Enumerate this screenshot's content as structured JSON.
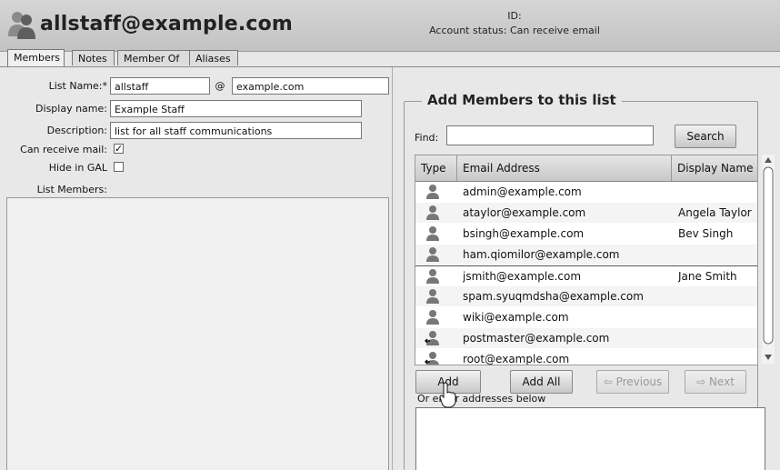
{
  "header": {
    "title": "allstaff@example.com",
    "id_label": "ID:",
    "account_status": "Account status:  Can receive email"
  },
  "tabs": [
    "Members",
    "Notes",
    "Member Of",
    "Aliases"
  ],
  "form": {
    "list_name_label": "List Name:*",
    "list_name_value": "allstaff",
    "at_sign": "@",
    "domain_value": "example.com",
    "display_name_label": "Display name:",
    "display_name_value": "Example Staff",
    "description_label": "Description:",
    "description_value": "list for all staff communications",
    "can_receive_label": "Can receive mail:",
    "can_receive_checked": true,
    "hide_gal_label": "Hide in GAL",
    "hide_gal_checked": false,
    "list_members_label": "List Members:"
  },
  "add_panel": {
    "legend": "Add Members to this list",
    "find_label": "Find:",
    "find_value": "",
    "search_button": "Search",
    "columns": [
      "Type",
      "Email Address",
      "Display Name"
    ],
    "rows": [
      {
        "type_icon": "user-icon",
        "email": "admin@example.com",
        "display": ""
      },
      {
        "type_icon": "user-icon",
        "email": "ataylor@example.com",
        "display": "Angela Taylor"
      },
      {
        "type_icon": "user-icon",
        "email": "bsingh@example.com",
        "display": "Bev Singh"
      },
      {
        "type_icon": "user-icon",
        "email": "ham.qiomilor@example.com",
        "display": ""
      },
      {
        "type_icon": "user-icon",
        "email": "jsmith@example.com",
        "display": "Jane Smith"
      },
      {
        "type_icon": "user-icon",
        "email": "spam.syuqmdsha@example.com",
        "display": ""
      },
      {
        "type_icon": "user-icon",
        "email": "wiki@example.com",
        "display": ""
      },
      {
        "type_icon": "alias-icon",
        "email": "postmaster@example.com",
        "display": ""
      },
      {
        "type_icon": "alias-icon",
        "email": "root@example.com",
        "display": ""
      }
    ],
    "add_button": "Add",
    "add_all_button": "Add All",
    "previous_button": "Previous",
    "next_button": "Next",
    "other_addresses_hint": "Or enter addresses below"
  }
}
